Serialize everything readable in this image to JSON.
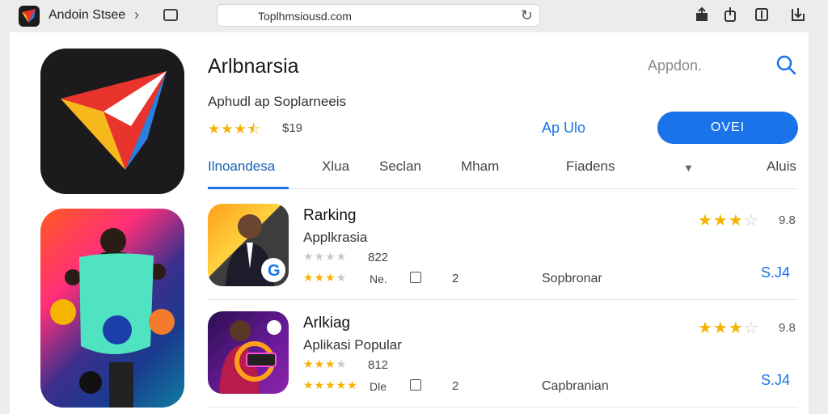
{
  "toolbar": {
    "app_name": "Andoin Stsee",
    "address": "Toplhmsiousd.com"
  },
  "app": {
    "title": "Arlbnarsia",
    "subtitle": "Aphudl ap Soplarneeis",
    "rating_stars": 3.5,
    "price": "$19",
    "right_label": "Appdon.",
    "app_info_link": "Ap Ulo",
    "get_button": "OVEI"
  },
  "tabs": [
    "Ilnoandesa",
    "Xlua",
    "Seclan",
    "Mham",
    "Fiadens",
    "Aluis"
  ],
  "rows": [
    {
      "title": "Rarking",
      "subtitle": "Applkrasia",
      "count": "822",
      "tag": "Ne.",
      "downloads": "2",
      "developer": "Sopbronar",
      "rating": "9.8",
      "price": "S.J4"
    },
    {
      "title": "Arlkiag",
      "subtitle": "Aplikasi Popular",
      "count": "812",
      "tag": "Dle",
      "downloads": "2",
      "developer": "Capbranian",
      "rating": "9.8",
      "price": "S.J4"
    }
  ],
  "colors": {
    "accent": "#1a73e8",
    "star": "#f5b301"
  },
  "icons": [
    "app-logo-icon",
    "chevron-right-icon",
    "sidebar-icon",
    "reload-icon",
    "share-icon",
    "upload-icon",
    "book-icon",
    "download-icon",
    "search-icon",
    "chevron-down-icon"
  ]
}
